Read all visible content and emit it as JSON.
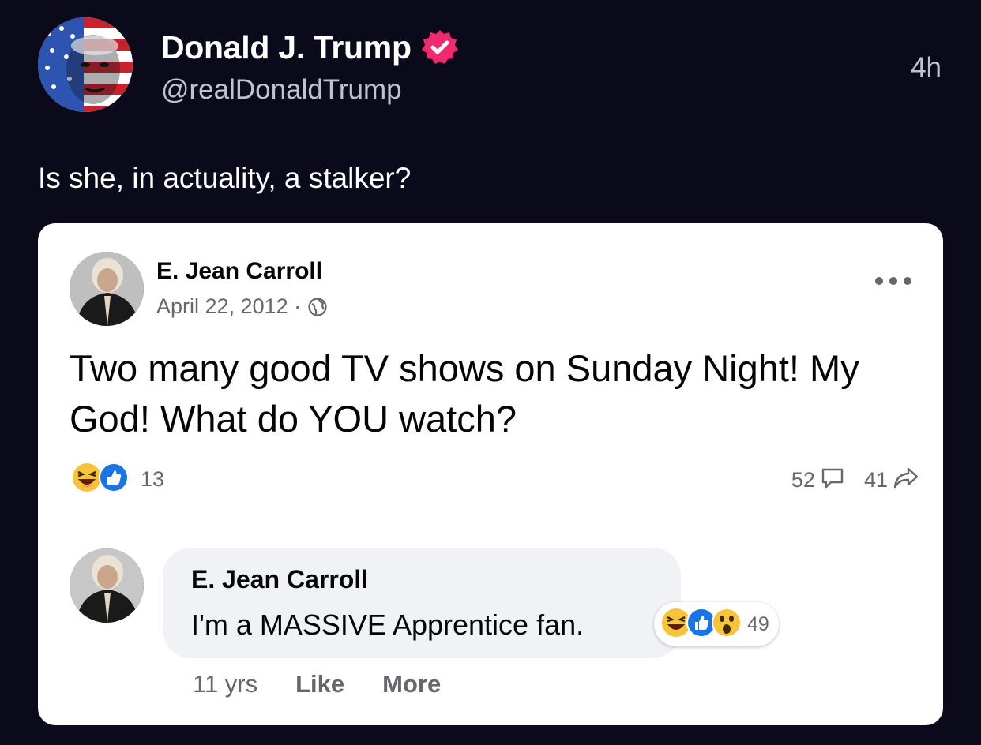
{
  "post": {
    "author_name": "Donald J. Trump",
    "author_handle": "@realDonaldTrump",
    "time": "4h",
    "text": "Is she, in actuality, a stalker?",
    "verified_color": "#f02a6d"
  },
  "embedded": {
    "author_name": "E. Jean Carroll",
    "date": "April 22, 2012 ·",
    "text": "Two many good TV shows on Sunday Night! My God! What do YOU watch?",
    "reaction_count": "13",
    "comment_count": "52",
    "share_count": "41",
    "comment": {
      "author_name": "E. Jean Carroll",
      "text": "I'm a MASSIVE Apprentice fan.",
      "reaction_count": "49",
      "time": "11 yrs",
      "like_label": "Like",
      "more_label": "More"
    }
  }
}
